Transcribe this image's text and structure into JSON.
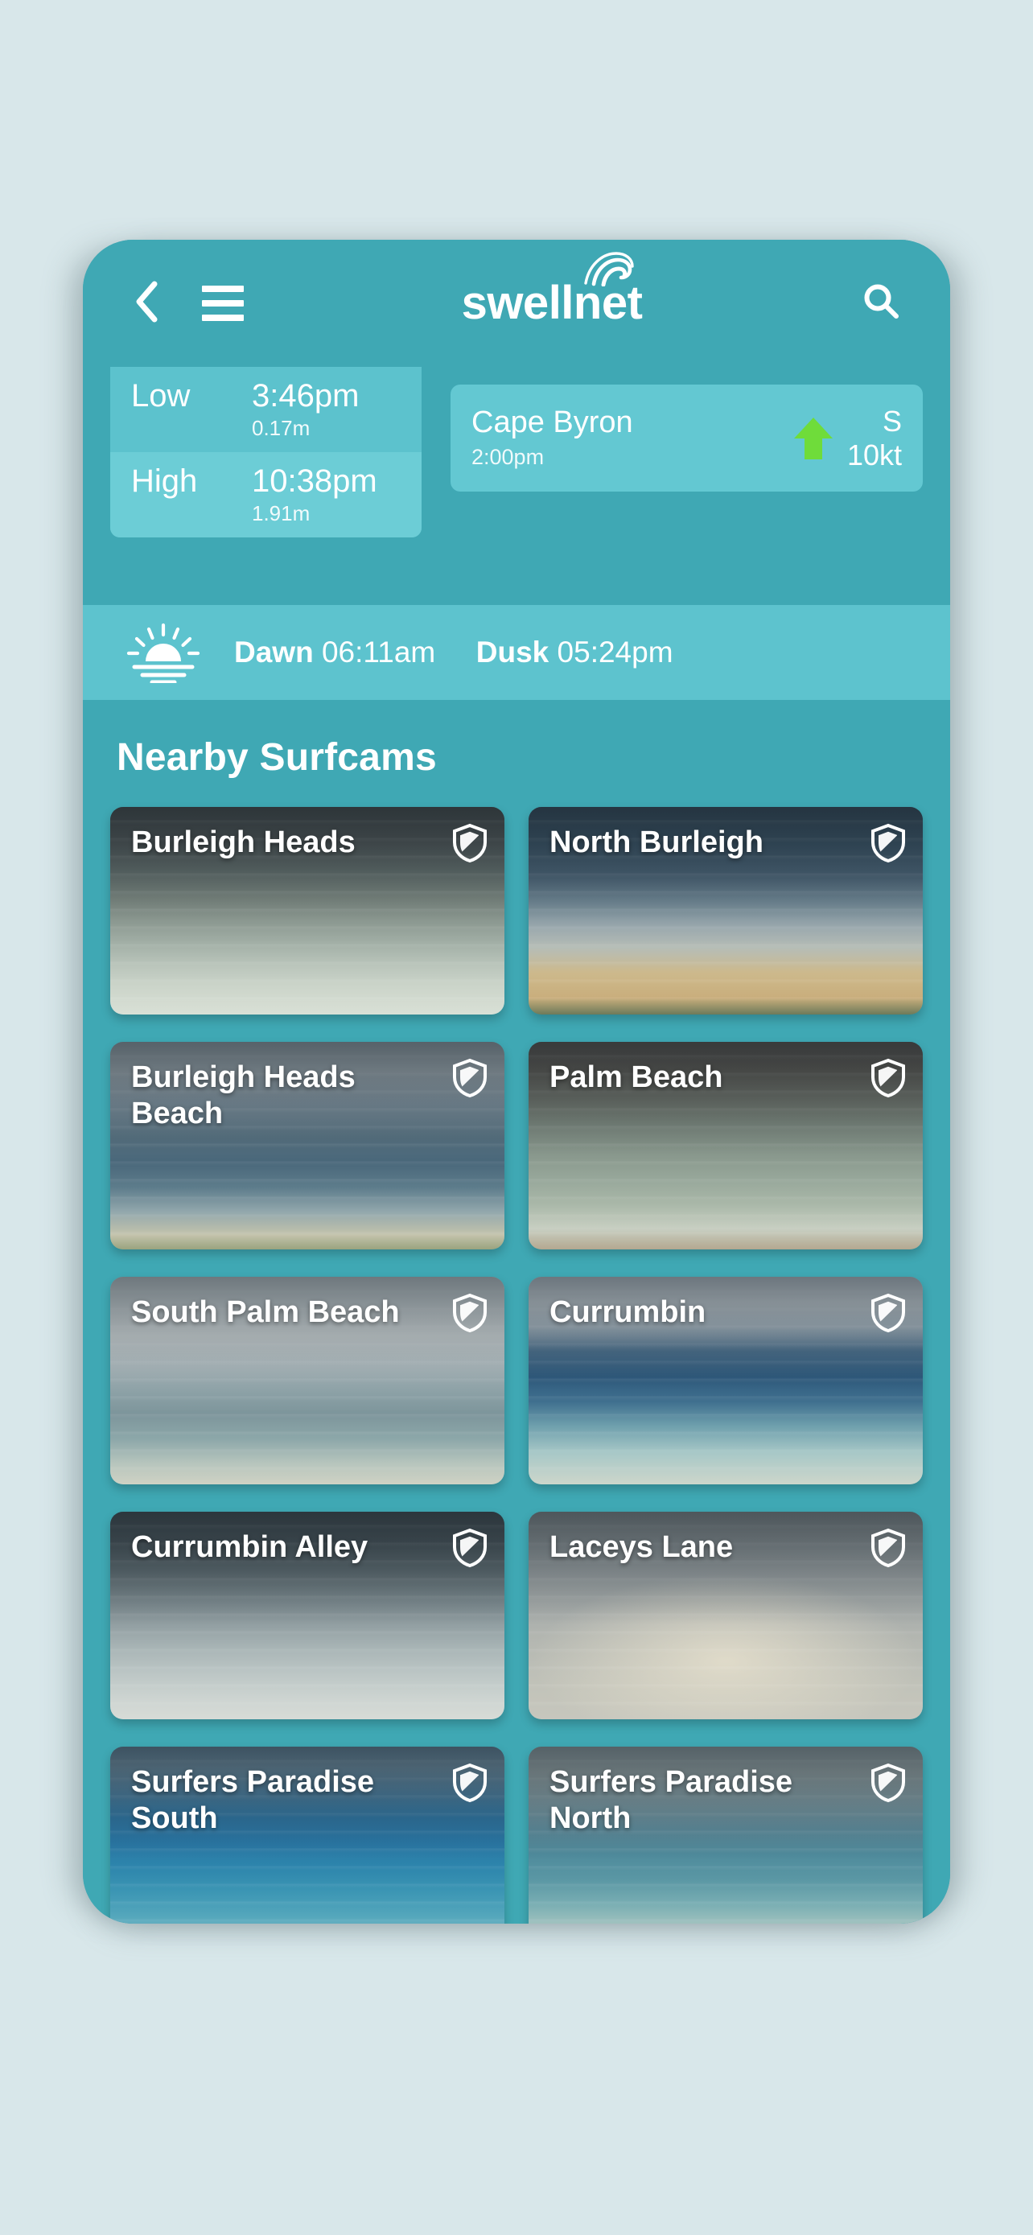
{
  "app": {
    "logo_text": "swellnet",
    "back_icon": "chevron-left-icon",
    "menu_icon": "hamburger-menu-icon",
    "search_icon": "search-icon",
    "wave_icon": "wave-logo-icon",
    "accent_color": "#3fa8b4",
    "panel_color": "#5dc3ce",
    "page_background": "#d8e7ea",
    "wind_arrow_color": "#6fdc3a"
  },
  "tides": [
    {
      "label": "Low",
      "time": "3:46pm",
      "height": "0.17m"
    },
    {
      "label": "High",
      "time": "10:38pm",
      "height": "1.91m"
    }
  ],
  "wind": {
    "spot": "Cape Byron",
    "time": "2:00pm",
    "direction": "S",
    "speed": "10kt",
    "arrow_icon": "wind-direction-arrow-icon"
  },
  "daylight": {
    "icon": "sunrise-icon",
    "dawn_label": "Dawn",
    "dawn_time": "06:11am",
    "dusk_label": "Dusk",
    "dusk_time": "05:24pm"
  },
  "surfcams": {
    "title": "Nearby Surfcams",
    "badge_icon": "shield-icon",
    "items": [
      {
        "name": "Burleigh Heads",
        "photo_class": "ph-burleigh-heads"
      },
      {
        "name": "North Burleigh",
        "photo_class": "ph-north-burleigh"
      },
      {
        "name": "Burleigh Heads Beach",
        "photo_class": "ph-burleigh-heads-beach"
      },
      {
        "name": "Palm Beach",
        "photo_class": "ph-palm-beach"
      },
      {
        "name": "South Palm Beach",
        "photo_class": "ph-south-palm-beach"
      },
      {
        "name": "Currumbin",
        "photo_class": "ph-currumbin"
      },
      {
        "name": "Currumbin Alley",
        "photo_class": "ph-currumbin-alley"
      },
      {
        "name": "Laceys Lane",
        "photo_class": "ph-laceys-lane"
      },
      {
        "name": "Surfers Paradise South",
        "photo_class": "ph-surfers-paradise-south"
      },
      {
        "name": "Surfers Paradise North",
        "photo_class": "ph-surfers-paradise-north"
      }
    ]
  }
}
